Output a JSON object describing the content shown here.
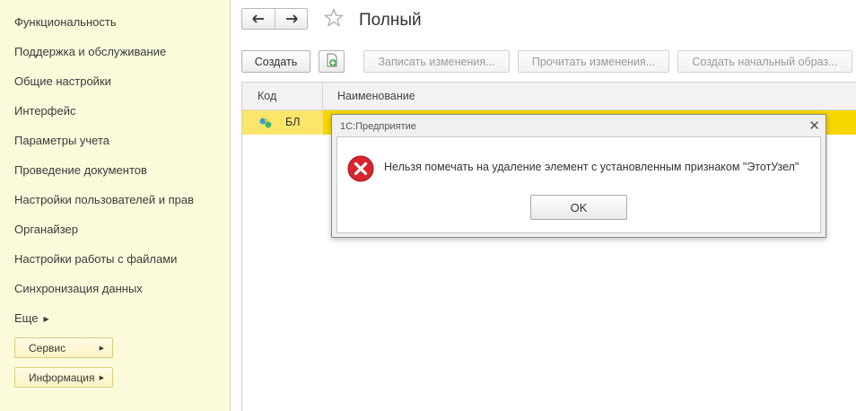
{
  "sidebar": {
    "items": [
      {
        "label": "Функциональность"
      },
      {
        "label": "Поддержка и обслуживание"
      },
      {
        "label": "Общие настройки"
      },
      {
        "label": "Интерфейс"
      },
      {
        "label": "Параметры учета"
      },
      {
        "label": "Проведение документов"
      },
      {
        "label": "Настройки пользователей и прав"
      },
      {
        "label": "Органайзер"
      },
      {
        "label": "Настройки работы с файлами"
      },
      {
        "label": "Синхронизация данных"
      }
    ],
    "more_label": "Еще",
    "service_label": "Сервис",
    "info_label": "Информация"
  },
  "header": {
    "title": "Полный",
    "back_icon": "arrow-left-icon",
    "forward_icon": "arrow-right-icon",
    "favorite_icon": "star-icon"
  },
  "toolbar": {
    "create_label": "Создать",
    "copy_icon": "create-copy-icon",
    "write_changes_label": "Записать изменения...",
    "read_changes_label": "Прочитать изменения...",
    "initial_image_label": "Создать начальный образ..."
  },
  "table": {
    "columns": [
      "Код",
      "Наименование"
    ],
    "rows": [
      {
        "code": "БЛ",
        "name": "",
        "icon": "exchange-node-icon"
      }
    ],
    "selected_color": "#fce66a"
  },
  "dialog": {
    "title": "1С:Предприятие",
    "message": "Нельзя помечать на удаление элемент с установленным признаком \"ЭтотУзел\"",
    "ok_label": "OK",
    "icon": "error-icon",
    "error_color": "#d9242f"
  }
}
